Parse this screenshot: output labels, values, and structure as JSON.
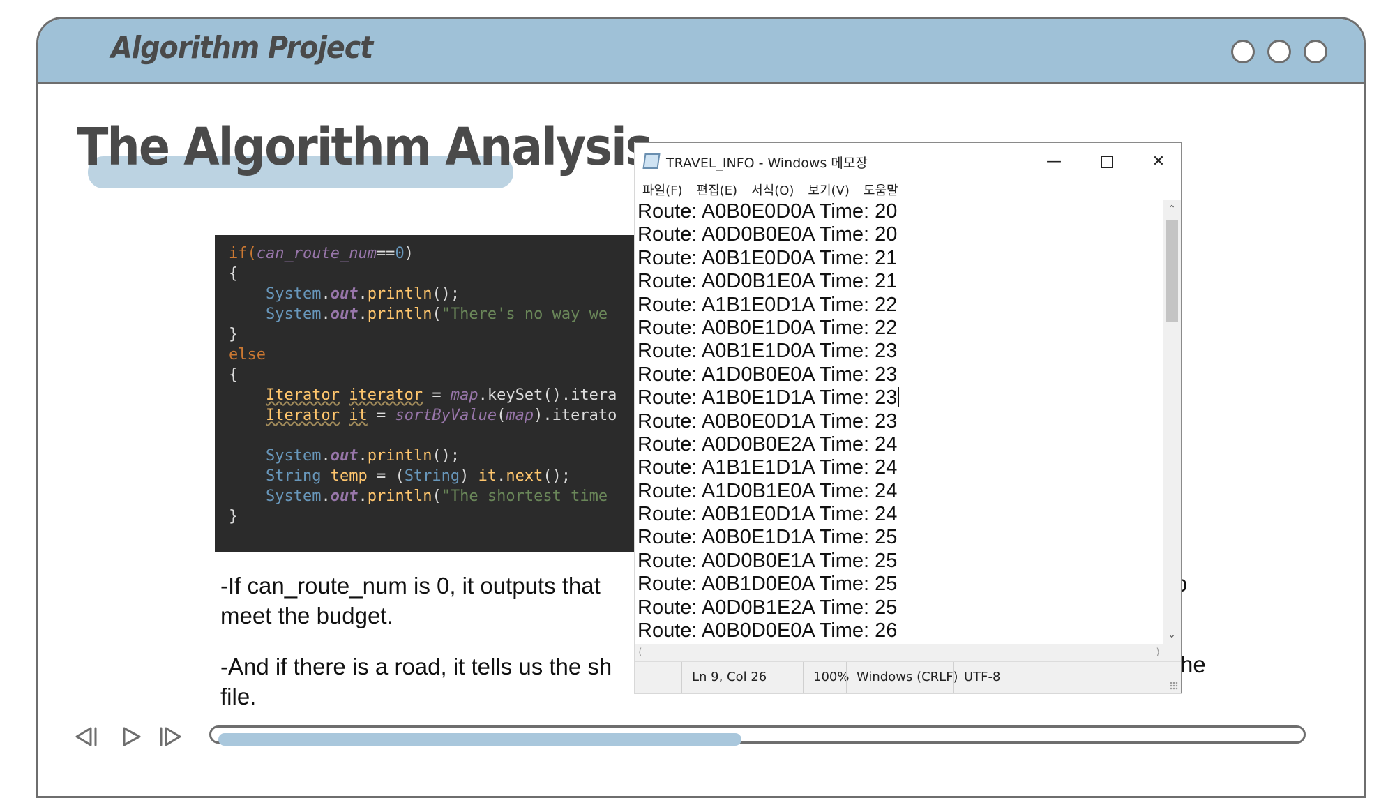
{
  "slide": {
    "header_title": "Algorithm Project",
    "title": "The Algorithm Analysis",
    "paragraph1": "-If can_route_num is 0, it outputs that",
    "paragraph1_tail_char": "o",
    "paragraph1_line2": "meet the budget.",
    "paragraph2": "-And if there is a road, it tells us the sh",
    "paragraph2_tail": "he",
    "paragraph2_line2": "file.",
    "progress_fraction": 0.5
  },
  "code": {
    "lines": [
      [
        "if(",
        "can_route_num",
        "==",
        "0",
        ")"
      ],
      [
        "{"
      ],
      [
        "    ",
        "System",
        ".",
        "out",
        ".",
        "println",
        "();"
      ],
      [
        "    ",
        "System",
        ".",
        "out",
        ".",
        "println",
        "(",
        "\"There's no way we"
      ],
      [
        "}"
      ],
      [
        "else"
      ],
      [
        "{"
      ],
      [
        "    ",
        "Iterator",
        " ",
        "iterator",
        " = ",
        "map",
        ".keySet().itera"
      ],
      [
        "    ",
        "Iterator",
        " ",
        "it",
        " = ",
        "sortByValue",
        "(",
        "map",
        ").iterato"
      ],
      [
        ""
      ],
      [
        "    ",
        "System",
        ".",
        "out",
        ".",
        "println",
        "();"
      ],
      [
        "    ",
        "String",
        " ",
        "temp",
        " = (",
        "String",
        ") ",
        "it",
        ".",
        "next",
        "();"
      ],
      [
        "    ",
        "System",
        ".",
        "out",
        ".",
        "println",
        "(",
        "\"The shortest time"
      ],
      [
        "}"
      ]
    ]
  },
  "notepad": {
    "title": "TRAVEL_INFO - Windows 메모장",
    "menu": [
      "파일(F)",
      "편집(E)",
      "서식(O)",
      "보기(V)",
      "도움말"
    ],
    "lines": [
      "Route: A0B0E0D0A Time: 20",
      "Route: A0D0B0E0A Time: 20",
      "Route: A0B1E0D0A Time: 21",
      "Route: A0D0B1E0A Time: 21",
      "Route: A1B1E0D1A Time: 22",
      "Route: A0B0E1D0A Time: 22",
      "Route: A0B1E1D0A Time: 23",
      "Route: A1D0B0E0A Time: 23",
      "Route: A1B0E1D1A Time: 23",
      "Route: A0B0E0D1A Time: 23",
      "Route: A0D0B0E2A Time: 24",
      "Route: A1B1E1D1A Time: 24",
      "Route: A1D0B1E0A Time: 24",
      "Route: A0B1E0D1A Time: 24",
      "Route: A0B0E1D1A Time: 25",
      "Route: A0D0B0E1A Time: 25",
      "Route: A0B1D0E0A Time: 25",
      "Route: A0D0B1E2A Time: 25",
      "Route: A0B0D0E0A Time: 26"
    ],
    "caret_line": 8,
    "status": {
      "position": "Ln 9, Col 26",
      "zoom": "100%",
      "line_ending": "Windows (CRLF)",
      "encoding": "UTF-8"
    }
  }
}
